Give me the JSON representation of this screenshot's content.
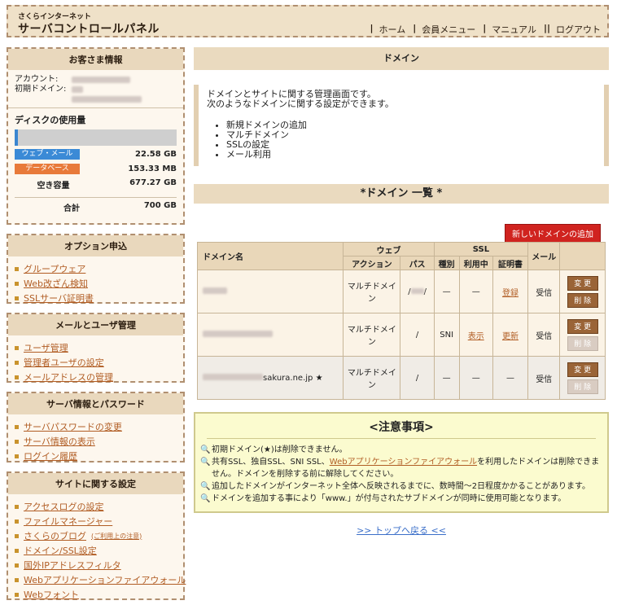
{
  "header": {
    "brand_small": "さくらインターネット",
    "brand": "サーバコントロールパネル",
    "nav": [
      "ホーム",
      "会員メニュー",
      "マニュアル",
      "ログアウト"
    ]
  },
  "customer": {
    "title": "お客さま情報",
    "account_label": "アカウント:",
    "domain_label": "初期ドメイン:",
    "disk_title": "ディスクの使用量",
    "disk_used_fraction": 0.02,
    "web_mail_label": "ウェブ・メール",
    "web_mail_value": "22.58 GB",
    "db_label": "データベース",
    "db_value": "153.33 MB",
    "free_label": "空き容量",
    "free_value": "677.27 GB",
    "total_label": "合計",
    "total_value": "700 GB"
  },
  "option": {
    "title": "オプション申込",
    "items": [
      "グループウェア",
      "Web改ざん検知",
      "SSLサーバ証明書"
    ]
  },
  "mail": {
    "title": "メールとユーザ管理",
    "items": [
      "ユーザ管理",
      "管理者ユーザの設定",
      "メールアドレスの管理"
    ]
  },
  "server": {
    "title": "サーバ情報とパスワード",
    "items": [
      "サーバパスワードの変更",
      "サーバ情報の表示",
      "ログイン履歴"
    ]
  },
  "site": {
    "title": "サイトに関する設定",
    "items": [
      "アクセスログの設定",
      "ファイルマネージャー",
      "さくらのブログ",
      "ドメイン/SSL設定",
      "国外IPアドレスフィルタ",
      "Webアプリケーションファイアウォール",
      "Webフォント"
    ],
    "blog_note": "(ご利用上の注意)"
  },
  "main": {
    "title": "ドメイン",
    "intro_line1": "ドメインとサイトに関する管理画面です。",
    "intro_line2": "次のようなドメインに関する設定ができます。",
    "intro_items": [
      "新規ドメインの追加",
      "マルチドメイン",
      "SSLの設定",
      "メール利用"
    ],
    "list_title": "*ドメイン 一覧 *",
    "add_button": "新しいドメインの追加"
  },
  "table": {
    "h_domain": "ドメイン名",
    "h_web": "ウェブ",
    "h_ssl": "SSL",
    "h_mail": "メール",
    "h_action": "アクション",
    "h_path": "パス",
    "h_type": "種別",
    "h_inuse": "利用中",
    "h_cert": "証明書",
    "rows": [
      {
        "domain_suffix": "",
        "action": "マルチドメイン",
        "path": "/",
        "type": "—",
        "inuse": "—",
        "cert": "登録",
        "mail": "受信",
        "change": "変 更",
        "delete": "削 除"
      },
      {
        "domain_suffix": "",
        "action": "マルチドメイン",
        "path": "/",
        "type": "SNI",
        "inuse": "表示",
        "cert": "更新",
        "mail": "受信",
        "change": "変 更",
        "delete": "削 除"
      },
      {
        "domain_suffix": "sakura.ne.jp",
        "action": "マルチドメイン",
        "path": "/",
        "type": "—",
        "inuse": "—",
        "cert": "—",
        "mail": "受信",
        "change": "変 更",
        "delete": "削 除"
      }
    ]
  },
  "notice": {
    "title": "<注意事項>",
    "line1": "初期ドメイン(★)は削除できません。",
    "line2a": "共有SSL、独自SSL、SNI SSL、",
    "line2_link": "Webアプリケーションファイアウォール",
    "line2b": "を利用したドメインは削除できません。ドメインを削除する前に解除してください。",
    "line3": "追加したドメインがインターネット全体へ反映されるまでに、数時間〜2日程度かかることがあります。",
    "line4": "ドメインを追加する事により「www.」が付与されたサブドメインが同時に使用可能となります。"
  },
  "back_link": ">> トップへ戻る <<"
}
